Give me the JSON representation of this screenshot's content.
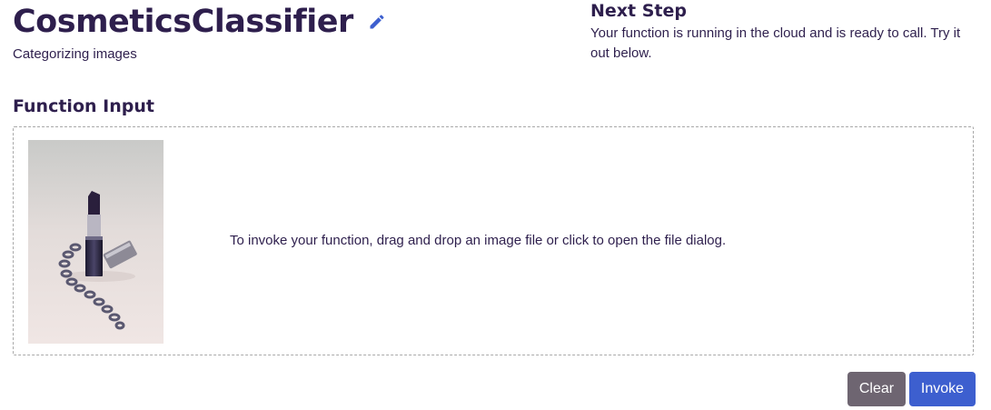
{
  "header": {
    "title": "CosmeticsClassifier",
    "subtitle": "Categorizing images",
    "edit_icon": "pencil-icon"
  },
  "next_step": {
    "title": "Next Step",
    "text": "Your function is running in the cloud and is ready to call. Try it out below."
  },
  "input": {
    "section_title": "Function Input",
    "drop_text": "To invoke your function, drag and drop an image file or click to open the file dialog.",
    "thumbnail": "lipstick-product-photo"
  },
  "actions": {
    "clear_label": "Clear",
    "invoke_label": "Invoke"
  },
  "colors": {
    "text": "#2e1f4d",
    "accent": "#3d5fcf",
    "clear_button": "#6e6571"
  }
}
